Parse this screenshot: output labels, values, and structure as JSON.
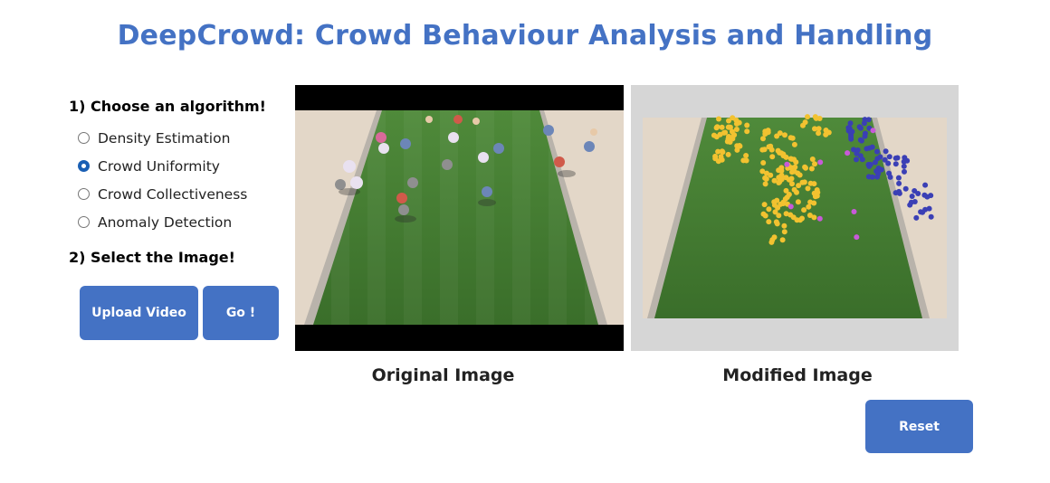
{
  "page": {
    "title": "DeepCrowd: Crowd Behaviour Analysis and Handling"
  },
  "controls": {
    "step1_heading": "1) Choose an algorithm!",
    "algorithms": [
      {
        "label": "Density Estimation",
        "selected": false
      },
      {
        "label": "Crowd Uniformity",
        "selected": true
      },
      {
        "label": "Crowd Collectiveness",
        "selected": false
      },
      {
        "label": "Anomaly Detection",
        "selected": false
      }
    ],
    "step2_heading": "2) Select the Image!",
    "upload_label": "Upload Video",
    "go_label": "Go !",
    "reset_label": "Reset"
  },
  "images": {
    "original_caption": "Original Image",
    "modified_caption": "Modified Image"
  },
  "colors": {
    "accent": "#4472c4",
    "radio_selected": "#1a5fb4",
    "cluster_yellow": "#f2c230",
    "cluster_blue": "#3a3fb5",
    "outlier_magenta": "#c85ad8"
  }
}
